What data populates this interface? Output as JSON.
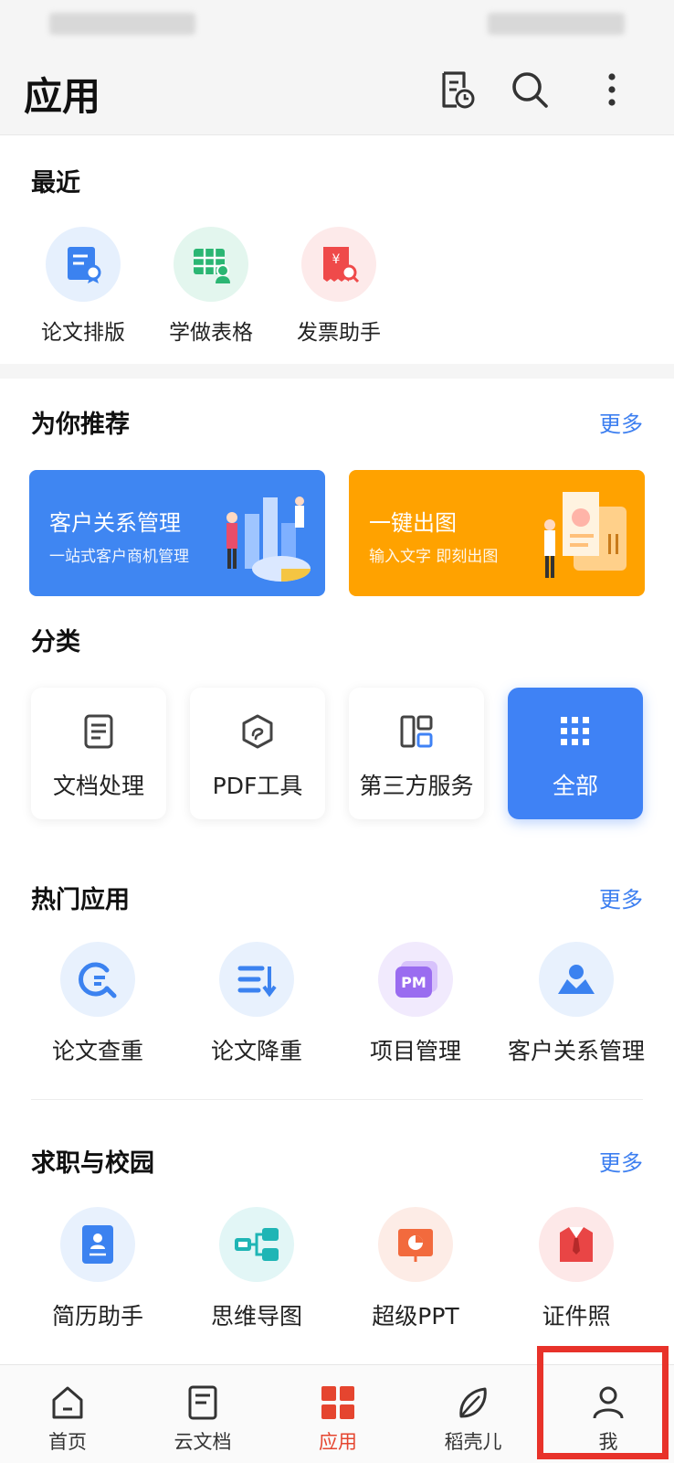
{
  "header": {
    "title": "应用"
  },
  "recent": {
    "title": "最近",
    "items": [
      {
        "label": "论文排版",
        "icon": "thesis-format-icon"
      },
      {
        "label": "学做表格",
        "icon": "learn-table-icon"
      },
      {
        "label": "发票助手",
        "icon": "invoice-icon"
      }
    ]
  },
  "recommend": {
    "title": "为你推荐",
    "more": "更多",
    "banners": [
      {
        "title": "客户关系管理",
        "subtitle": "一站式客户商机管理",
        "color": "#3f86f2"
      },
      {
        "title": "一键出图",
        "subtitle": "输入文字 即刻出图",
        "color": "#ffa200"
      }
    ]
  },
  "category": {
    "title": "分类",
    "items": [
      {
        "label": "文档处理"
      },
      {
        "label": "PDF工具"
      },
      {
        "label": "第三方服务"
      },
      {
        "label": "全部"
      }
    ]
  },
  "hot": {
    "title": "热门应用",
    "more": "更多",
    "items": [
      {
        "label": "论文查重"
      },
      {
        "label": "论文降重"
      },
      {
        "label": "项目管理"
      },
      {
        "label": "客户关系管理"
      }
    ]
  },
  "career": {
    "title": "求职与校园",
    "more": "更多",
    "items": [
      {
        "label": "简历助手"
      },
      {
        "label": "思维导图"
      },
      {
        "label": "超级PPT"
      },
      {
        "label": "证件照"
      }
    ]
  },
  "tabbar": {
    "items": [
      {
        "label": "首页"
      },
      {
        "label": "云文档"
      },
      {
        "label": "应用"
      },
      {
        "label": "稻壳儿"
      },
      {
        "label": "我"
      }
    ],
    "active_color": "#e5452f"
  },
  "colors": {
    "accent": "#3f82f5",
    "highlight": "#e8322a"
  }
}
